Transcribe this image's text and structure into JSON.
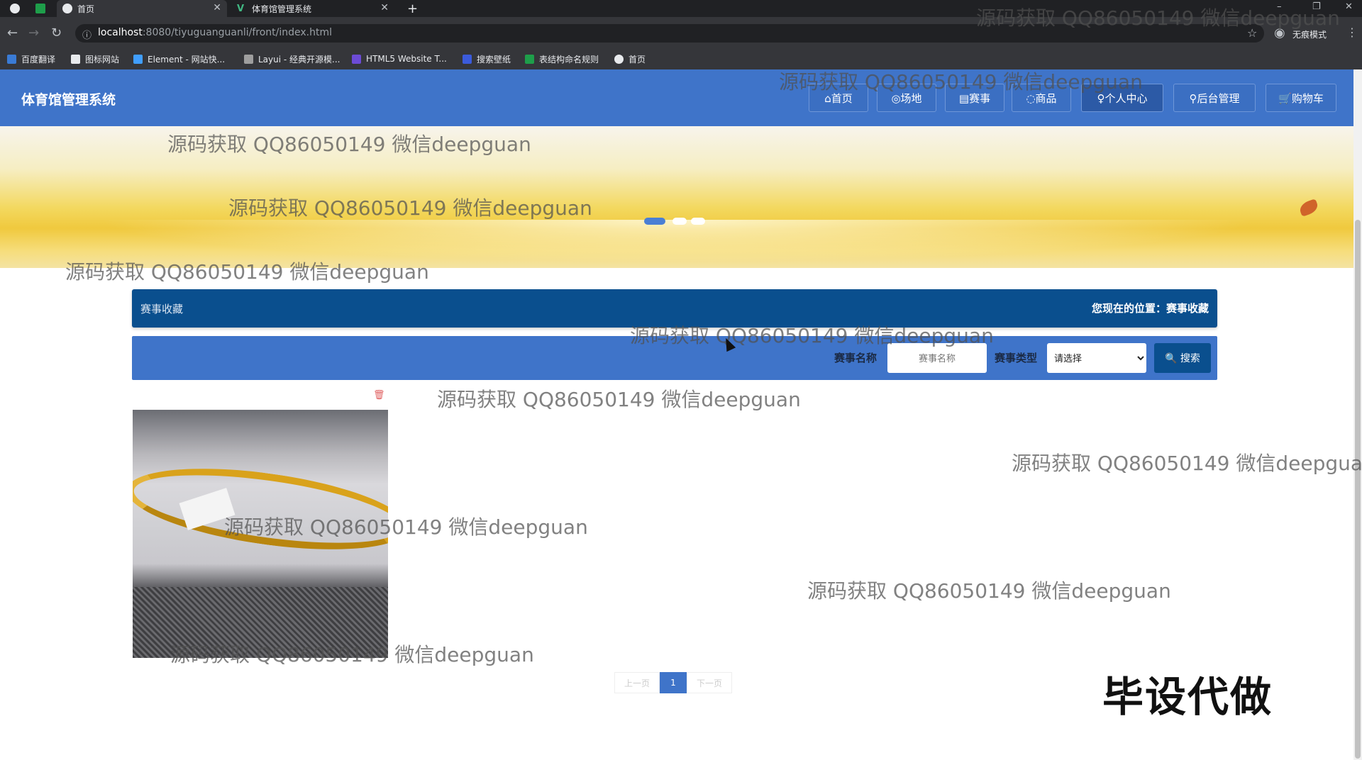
{
  "browser": {
    "tabs": [
      {
        "label": ""
      },
      {
        "label": ""
      },
      {
        "label": "首页"
      },
      {
        "label": "体育馆管理系统"
      }
    ],
    "new_tab": "+",
    "url_host": "localhost",
    "url_path": ":8080/tiyuguanguanli/front/index.html",
    "incognito_label": "无痕模式",
    "bookmarks": [
      {
        "label": "百度翻译",
        "color": "#3a7bd5"
      },
      {
        "label": "图标网站",
        "color": "#ffffff"
      },
      {
        "label": "Element - 网站快...",
        "color": "#409eff"
      },
      {
        "label": "Layui - 经典开源模...",
        "color": "#9e9e9e"
      },
      {
        "label": "HTML5 Website T...",
        "color": "#6c4bd6"
      },
      {
        "label": "搜索壁纸",
        "color": "#3b5bdb"
      },
      {
        "label": "表结构命名规则",
        "color": "#1e9e4a"
      },
      {
        "label": "首页",
        "color": "#e8eaed"
      }
    ]
  },
  "site": {
    "title": "体育馆管理系统",
    "nav": [
      {
        "label": "⌂首页"
      },
      {
        "label": "◎场地"
      },
      {
        "label": "▤赛事"
      },
      {
        "label": "◌商品"
      },
      {
        "label": "♀个人中心"
      },
      {
        "label": "⚲后台管理"
      },
      {
        "label": "🛒购物车"
      }
    ],
    "brand_color": "#3f74c9",
    "dark_color": "#0a4f8e"
  },
  "breadcrumb": {
    "section": "赛事收藏",
    "location_prefix": "您现在的位置：",
    "location": "赛事收藏"
  },
  "search": {
    "name_label": "赛事名称",
    "name_placeholder": "赛事名称",
    "type_label": "赛事类型",
    "type_selected": "请选择",
    "button_label": "🔍 搜索"
  },
  "pagination": {
    "prev": "上一页",
    "current": "1",
    "next": "下一页"
  },
  "corner_text": "毕设代做",
  "watermark": "源码获取 QQ86050149 微信deepguan"
}
